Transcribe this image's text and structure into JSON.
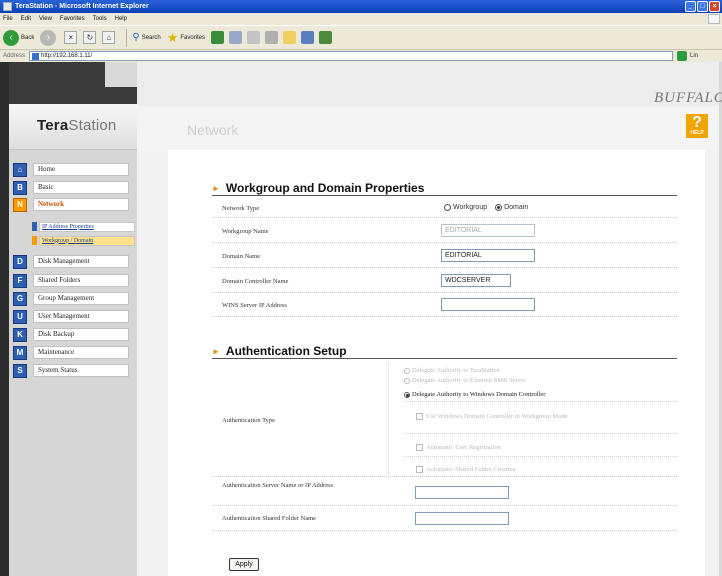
{
  "browser": {
    "title": "TeraStation - Microsoft Internet Explorer",
    "menu": [
      "File",
      "Edit",
      "View",
      "Favorites",
      "Tools",
      "Help"
    ],
    "toolbar": {
      "back": "Back",
      "search": "Search",
      "favorites": "Favorites"
    },
    "address_label": "Address",
    "address": "http://192.168.1.11/",
    "links_label": "Lin"
  },
  "brand": "BUFFALO",
  "logo": {
    "bold": "Tera",
    "light": "Station"
  },
  "help": {
    "glyph": "?",
    "label": "HELP"
  },
  "page_title": "Network",
  "nav": {
    "items": [
      {
        "label": "Home",
        "icon": "home-icon",
        "glyph": "⌂",
        "active": false
      },
      {
        "label": "Basic",
        "icon": "basic-icon",
        "glyph": "B",
        "active": false
      },
      {
        "label": "Network",
        "icon": "network-icon",
        "glyph": "N",
        "active": true
      },
      {
        "label": "Disk Management",
        "icon": "disk-icon",
        "glyph": "D",
        "active": false
      },
      {
        "label": "Shared Folders",
        "icon": "folder-icon",
        "glyph": "F",
        "active": false
      },
      {
        "label": "Group Management",
        "icon": "group-icon",
        "glyph": "G",
        "active": false
      },
      {
        "label": "User Management",
        "icon": "user-icon",
        "glyph": "U",
        "active": false
      },
      {
        "label": "Disk Backup",
        "icon": "backup-icon",
        "glyph": "K",
        "active": false
      },
      {
        "label": "Maintenance",
        "icon": "maintenance-icon",
        "glyph": "M",
        "active": false
      },
      {
        "label": "System Status",
        "icon": "status-icon",
        "glyph": "S",
        "active": false
      }
    ],
    "sub_items": [
      {
        "label": "IP Address Properties",
        "selected": false
      },
      {
        "label": "Workgroup / Domain",
        "selected": true
      }
    ]
  },
  "workgroup": {
    "section_title": "Workgroup and Domain Properties",
    "network_type": {
      "label": "Network Type",
      "options": [
        "Workgroup",
        "Domain"
      ],
      "selected": "Domain"
    },
    "workgroup_name": {
      "label": "Workgroup Name",
      "value": "EDITORIAL"
    },
    "domain_name": {
      "label": "Domain Name",
      "value": "EDITORIAL"
    },
    "domain_controller": {
      "label": "Domain Controller Name",
      "value": "WDCSERVER"
    },
    "wins_server": {
      "label": "WINS Server IP Address",
      "value": ""
    }
  },
  "auth": {
    "section_title": "Authentication Setup",
    "type_label": "Authentication Type",
    "options": [
      "Delegate Authority to TeraStation",
      "Delegate Authority to External SMB Server",
      "Delegate Authority to Windows Domain Controller"
    ],
    "selected_option": "Delegate Authority to Windows Domain Controller",
    "sub_options": [
      "Use Windows Domain Controller in Workgroup Mode",
      "Automatic User Registration",
      "Automatic Shared Folder Creation"
    ],
    "server_name": {
      "label": "Authentication Server Name or IP Address",
      "value": ""
    },
    "shared_folder": {
      "label": "Authentication Shared Folder Name",
      "value": ""
    }
  },
  "apply_label": "Apply"
}
